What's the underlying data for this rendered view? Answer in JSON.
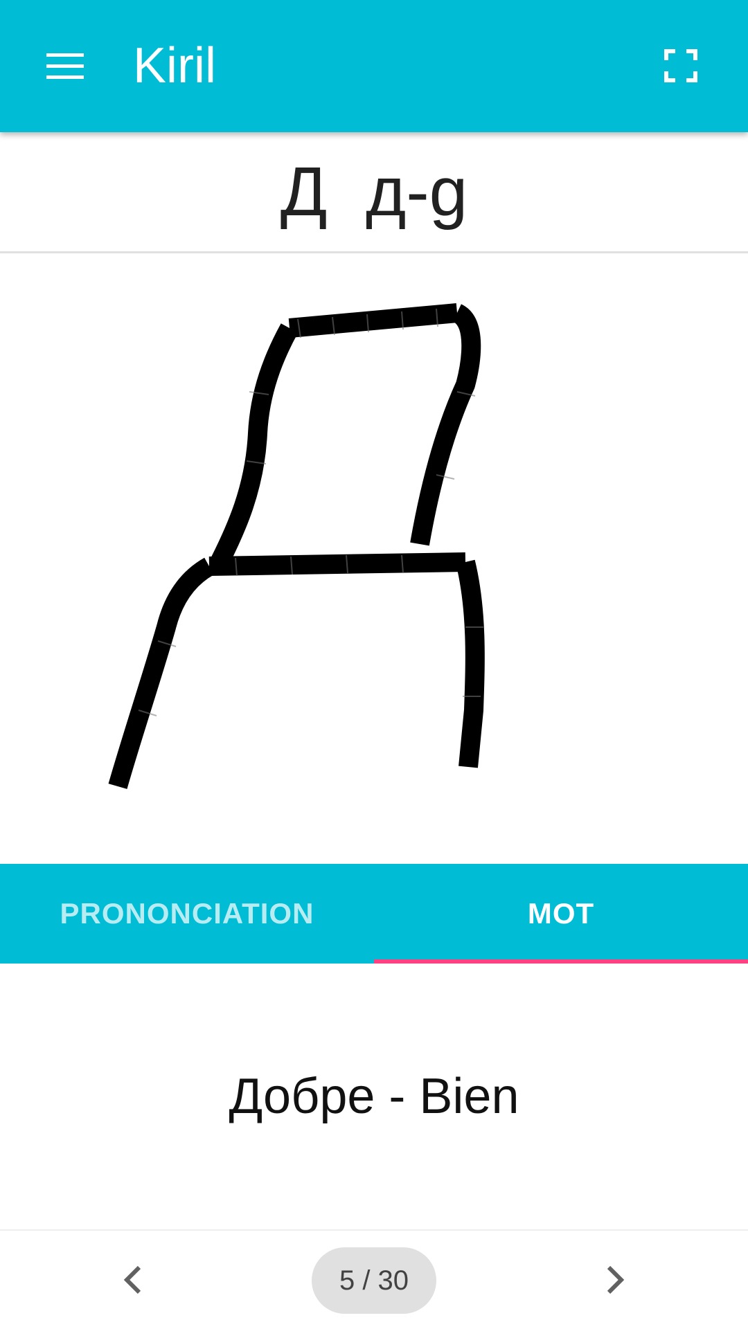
{
  "app_bar": {
    "title": "Kiril",
    "menu_icon": "hamburger-menu-icon",
    "fullscreen_icon": "fullscreen-icon",
    "color": "#00bcd4"
  },
  "letter_header": {
    "text": "Д  д-g"
  },
  "drawing": {
    "stroke_color": "#000000"
  },
  "tabs": [
    {
      "label": "PRONONCIATION",
      "active": false
    },
    {
      "label": "MOT",
      "active": true
    }
  ],
  "tab_indicator_color": "#ff4081",
  "word": {
    "text": "Добре - Bien"
  },
  "pagination": {
    "label": "5 / 30",
    "current": 5,
    "total": 30,
    "prev_icon": "chevron-left-icon",
    "next_icon": "chevron-right-icon"
  }
}
